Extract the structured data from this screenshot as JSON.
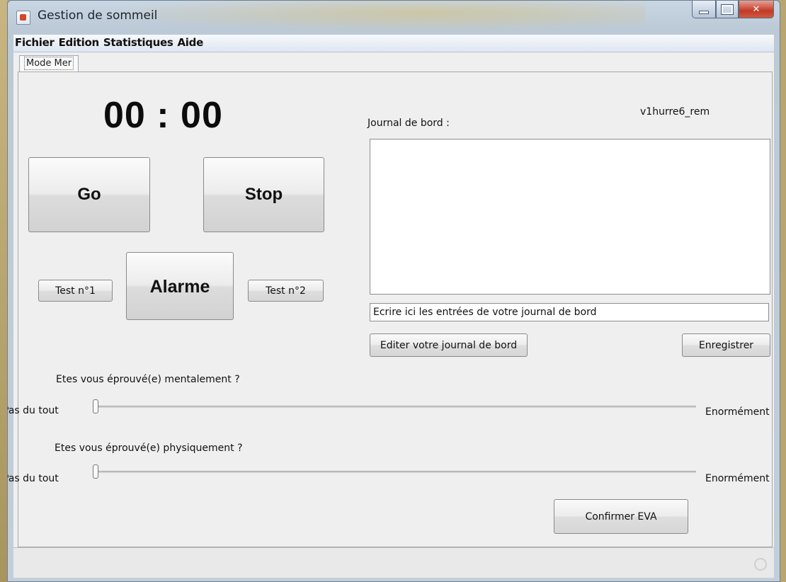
{
  "window": {
    "title": "Gestion de sommeil"
  },
  "menubar": {
    "items": [
      "Fichier",
      "Edition",
      "Statistiques",
      "Aide"
    ]
  },
  "tabs": [
    {
      "label": "Mode Mer",
      "selected": true
    }
  ],
  "left_panel": {
    "timer": "00 : 00",
    "go_label": "Go",
    "stop_label": "Stop",
    "alarm_label": "Alarme",
    "test1_label": "Test n°1",
    "test2_label": "Test n°2"
  },
  "right_panel": {
    "version": "v1hurre6_rem",
    "journal_label": "Journal de bord :",
    "journal_content": "",
    "entry_value": "Ecrire ici les entrées de votre journal de bord",
    "edit_button": "Editer votre journal de bord",
    "save_button": "Enregistrer"
  },
  "eva": {
    "mental": {
      "question": "Etes vous éprouvé(e) mentalement ?",
      "min_label": "Pas du tout",
      "max_label": "Enormément",
      "value": 0
    },
    "physical": {
      "question": "Etes vous éprouvé(e) physiquement ?",
      "min_label": "Pas du tout",
      "max_label": "Enormément",
      "value": 0
    },
    "confirm_label": "Confirmer EVA"
  },
  "colors": {
    "accent_menu": "#dfe6f1",
    "close_button": "#c23a25",
    "panel_bg": "#efefef"
  }
}
